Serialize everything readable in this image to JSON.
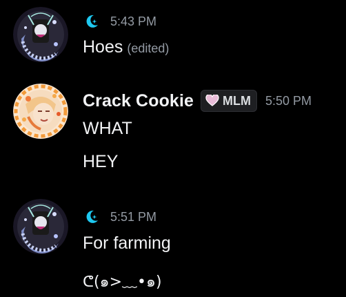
{
  "colors": {
    "background": "#000000",
    "text": "#f2f3f5",
    "muted": "#949ba4",
    "role_icon": "#1ec8f0"
  },
  "messages": [
    {
      "author_role_icon": "moon-star-icon",
      "timestamp": "5:43 PM",
      "lines": [
        {
          "text": "Hoes",
          "edited_label": "(edited)"
        }
      ]
    },
    {
      "author": "Crack Cookie",
      "tag": {
        "icon": "heart-icon",
        "label": "MLM"
      },
      "timestamp": "5:50 PM",
      "lines": [
        {
          "text": "WHAT"
        },
        {
          "text": "HEY"
        }
      ]
    },
    {
      "author_role_icon": "moon-star-icon",
      "timestamp": "5:51 PM",
      "lines": [
        {
          "text": "For farming"
        },
        {
          "text": "ᕦ(๑>﹏•๑)"
        }
      ]
    }
  ]
}
